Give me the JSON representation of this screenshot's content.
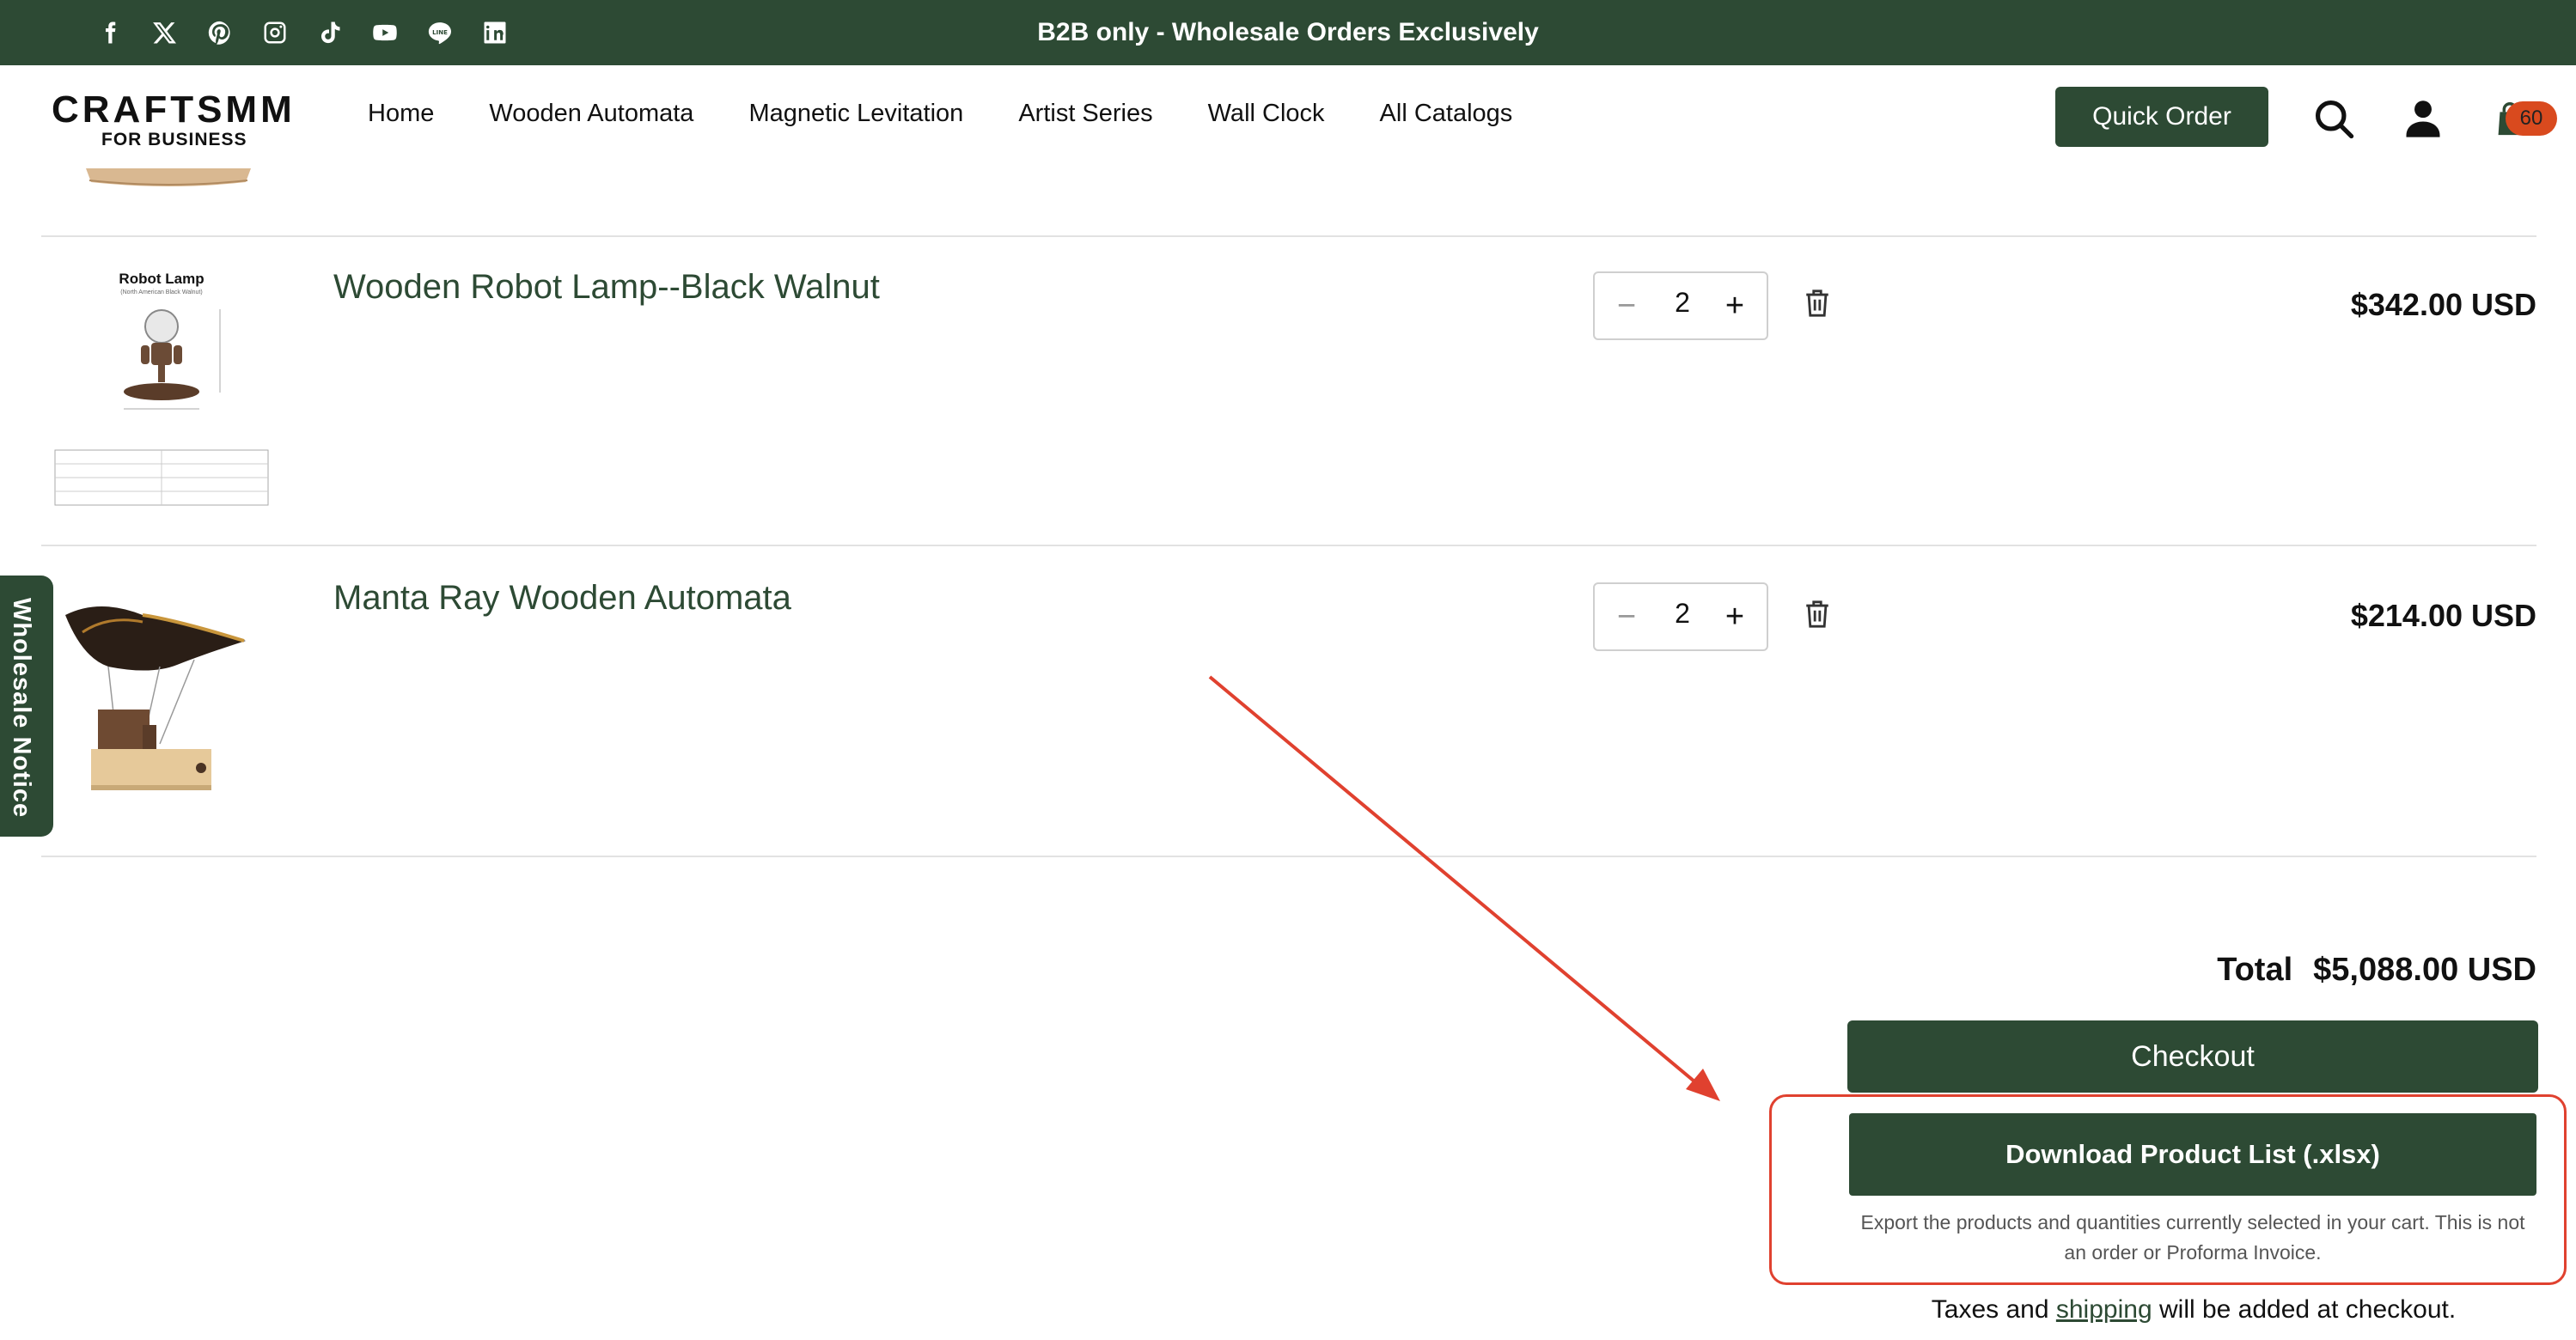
{
  "announcement": "B2B only - Wholesale Orders Exclusively",
  "social_icons": [
    "facebook-icon",
    "x-icon",
    "pinterest-icon",
    "instagram-icon",
    "tiktok-icon",
    "youtube-icon",
    "line-icon",
    "linkedin-icon"
  ],
  "logo": {
    "main": "CRAFTSMM",
    "sub": "FOR BUSINESS"
  },
  "nav": {
    "items": [
      {
        "label": "Home"
      },
      {
        "label": "Wooden Automata"
      },
      {
        "label": "Magnetic Levitation"
      },
      {
        "label": "Artist Series"
      },
      {
        "label": "Wall Clock"
      },
      {
        "label": "All Catalogs"
      }
    ]
  },
  "header": {
    "quick_order_label": "Quick Order",
    "icons": [
      "search-icon",
      "account-icon",
      "cart-icon"
    ],
    "cart_count": "60"
  },
  "cart": {
    "items": [
      {
        "title": "Wooden Robot Lamp--Black Walnut",
        "quantity": "2",
        "price": "$342.00 USD",
        "thumb_caption": "Robot Lamp",
        "thumb_subcaption": "(North American Black Walnut)"
      },
      {
        "title": "Manta Ray Wooden Automata",
        "quantity": "2",
        "price": "$214.00 USD"
      }
    ],
    "total_label": "Total",
    "total_value": "$5,088.00 USD",
    "checkout_label": "Checkout",
    "download_label": "Download Product List (.xlsx)",
    "export_note": "Export the products and quantities currently selected in your cart. This is not an order or Proforma Invoice.",
    "taxes_prefix": "Taxes and",
    "taxes_link": "shipping",
    "taxes_suffix": "will be added at checkout."
  },
  "side_tab_label": "Wholesale Notice",
  "annotation_color": "#e0412f",
  "colors": {
    "brand": "#2d4a34",
    "badge": "#d94a1e"
  }
}
